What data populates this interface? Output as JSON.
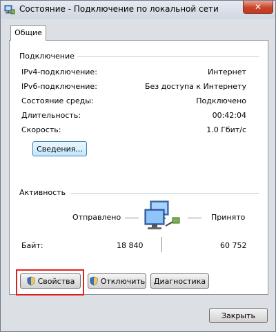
{
  "window": {
    "title": "Состояние - Подключение по локальной сети",
    "close_label": "✕"
  },
  "tabs": [
    {
      "label": "Общие",
      "active": true
    }
  ],
  "connection": {
    "group_title": "Подключение",
    "rows": [
      {
        "label": "IPv4-подключение:",
        "value": "Интернет"
      },
      {
        "label": "IPv6-подключение:",
        "value": "Без доступа к Интернету"
      },
      {
        "label": "Состояние среды:",
        "value": "Подключено"
      },
      {
        "label": "Длительность:",
        "value": "00:42:04"
      },
      {
        "label": "Скорость:",
        "value": "1.0 Гбит/с"
      }
    ],
    "details_button": "Сведения..."
  },
  "activity": {
    "group_title": "Активность",
    "sent_label": "Отправлено",
    "received_label": "Принято",
    "bytes_label": "Байт:",
    "bytes_sent": "18 840",
    "bytes_received": "60 752"
  },
  "buttons": {
    "properties": "Свойства",
    "disable": "Отключить",
    "diagnose": "Диагностика",
    "close": "Закрыть"
  },
  "colors": {
    "highlight": "#e02020",
    "close_button": "#c8442c"
  },
  "icons": {
    "title": "network-status-icon",
    "network": "network-computers-icon",
    "shield": "uac-shield-icon"
  }
}
